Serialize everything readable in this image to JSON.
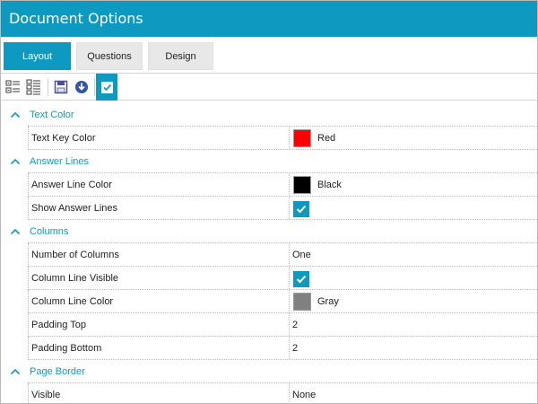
{
  "window": {
    "title": "Document Options"
  },
  "tabs": [
    {
      "label": "Layout",
      "active": true
    },
    {
      "label": "Questions",
      "active": false
    },
    {
      "label": "Design",
      "active": false
    }
  ],
  "toolbar": {
    "buttons": [
      {
        "icon": "categorized-view-icon"
      },
      {
        "icon": "alphabetical-view-icon"
      },
      {
        "icon": "save-icon"
      },
      {
        "icon": "load-icon"
      },
      {
        "icon": "checkbox-toggle-icon",
        "active": true
      }
    ]
  },
  "colors": {
    "accent": "#0e9ac0",
    "red": "#ff0000",
    "black": "#000000",
    "gray": "#808080"
  },
  "categories": [
    {
      "label": "Text Color",
      "properties": [
        {
          "name": "Text Key Color",
          "type": "color",
          "value": "Red",
          "swatch": "#ff0000"
        }
      ]
    },
    {
      "label": "Answer Lines",
      "properties": [
        {
          "name": "Answer Line Color",
          "type": "color",
          "value": "Black",
          "swatch": "#000000"
        },
        {
          "name": "Show Answer Lines",
          "type": "checkbox",
          "checked": true
        }
      ]
    },
    {
      "label": "Columns",
      "properties": [
        {
          "name": "Number of Columns",
          "type": "text",
          "value": "One"
        },
        {
          "name": "Column Line Visible",
          "type": "checkbox",
          "checked": true
        },
        {
          "name": "Column Line Color",
          "type": "color",
          "value": "Gray",
          "swatch": "#808080"
        },
        {
          "name": "Padding Top",
          "type": "text",
          "value": "2"
        },
        {
          "name": "Padding Bottom",
          "type": "text",
          "value": "2"
        }
      ]
    },
    {
      "label": "Page Border",
      "properties": [
        {
          "name": "Visible",
          "type": "text",
          "value": "None"
        }
      ]
    }
  ]
}
